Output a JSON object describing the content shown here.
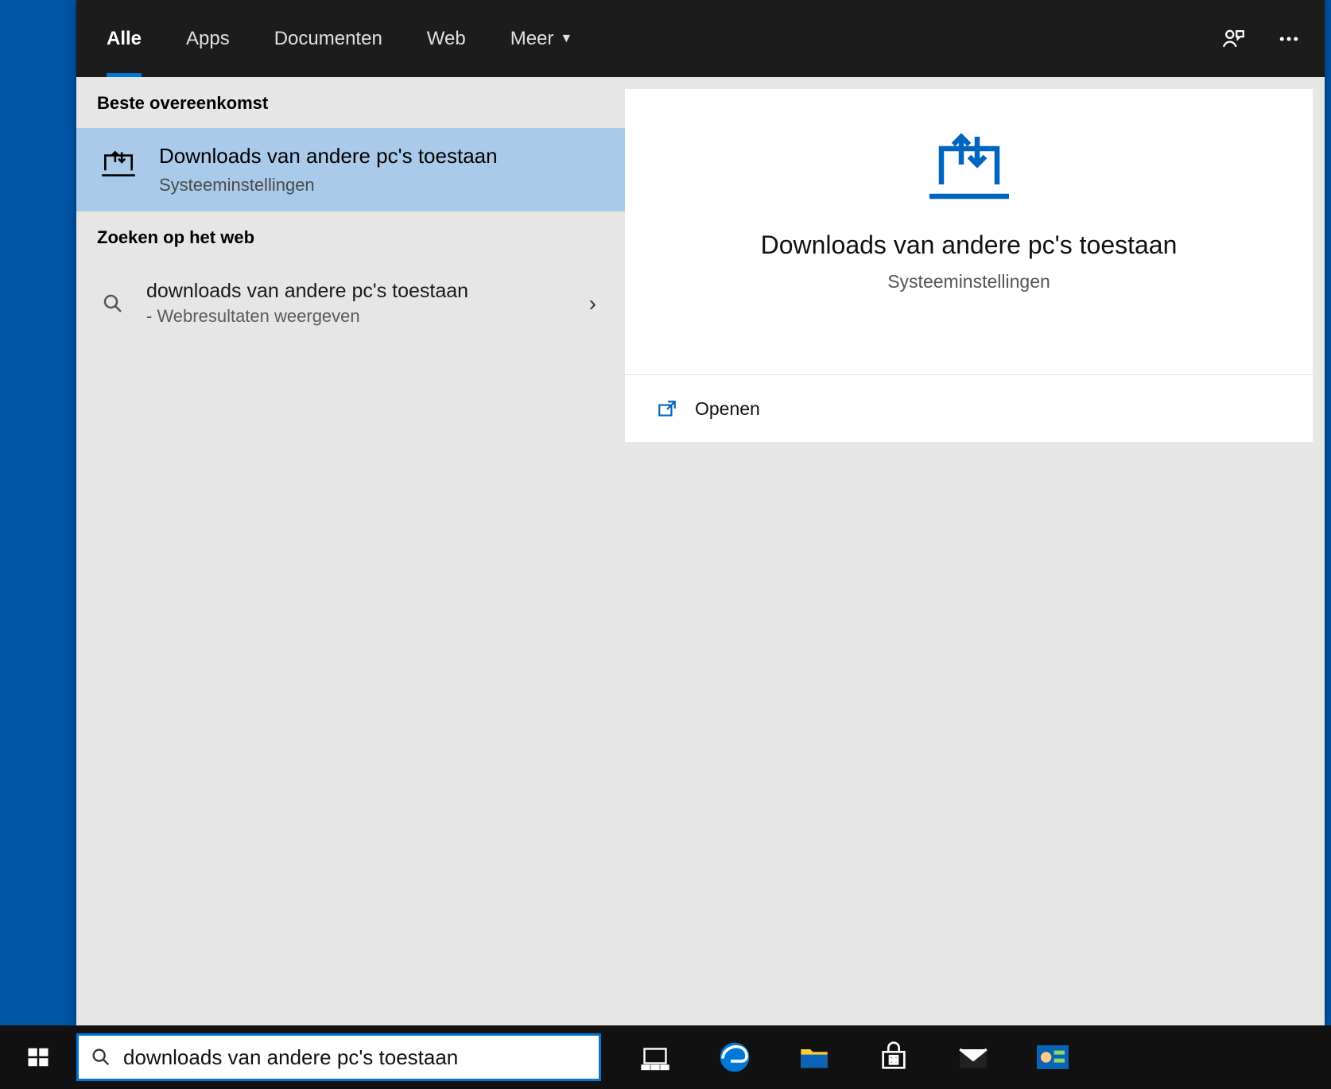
{
  "tabs": {
    "items": [
      "Alle",
      "Apps",
      "Documenten",
      "Web",
      "Meer"
    ],
    "active_index": 0
  },
  "left": {
    "best_header": "Beste overeenkomst",
    "best_title": "Downloads van andere pc's toestaan",
    "best_subtitle": "Systeeminstellingen",
    "web_header": "Zoeken op het web",
    "web_title": "downloads van andere pc's toestaan",
    "web_sub": "- Webresultaten weergeven"
  },
  "right": {
    "title": "Downloads van andere pc's toestaan",
    "subtitle": "Systeeminstellingen",
    "action_open": "Openen"
  },
  "search": {
    "value": "downloads van andere pc's toestaan"
  },
  "icons": {
    "feedback": "feedback-person-icon",
    "more": "more-horizontal-icon",
    "laptop_arrows": "laptop-arrows-icon",
    "search": "search-icon",
    "chevron_right": "chevron-right-icon",
    "chevron_down": "chevron-down-icon",
    "open_external": "open-external-icon",
    "windows": "windows-logo-icon",
    "task_view": "task-view-icon",
    "edge": "edge-browser-icon",
    "explorer": "file-explorer-icon",
    "store": "microsoft-store-icon",
    "mail": "mail-icon",
    "settings_tile": "control-panel-icon"
  }
}
